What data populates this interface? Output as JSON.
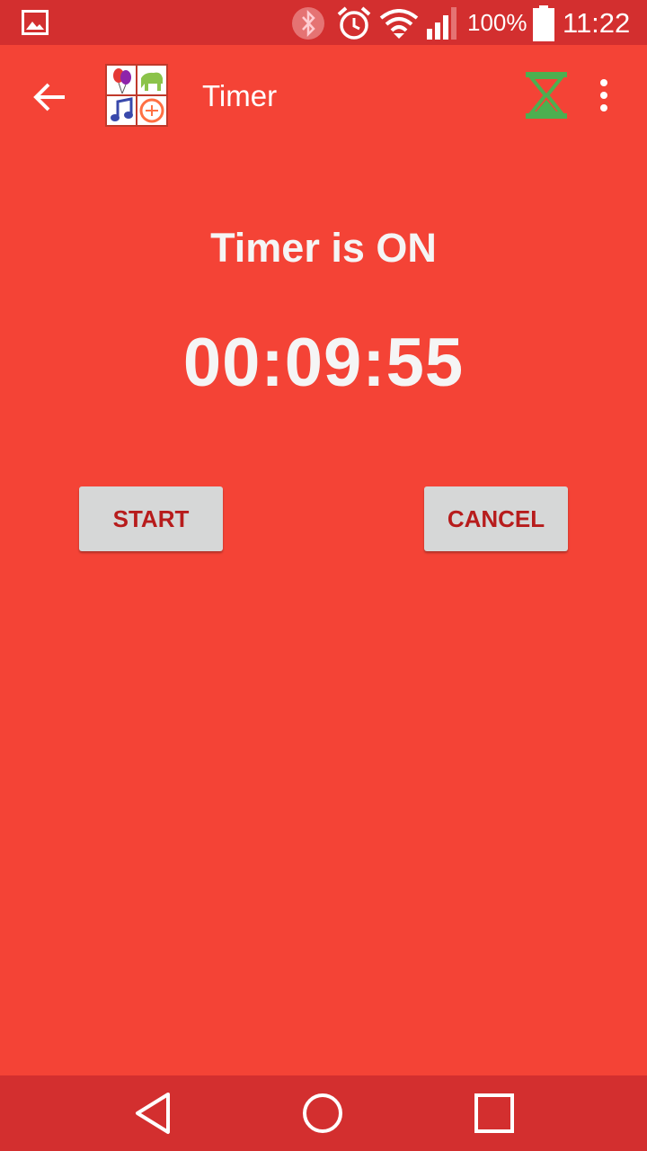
{
  "status_bar": {
    "battery_percent": "100%",
    "time": "11:22",
    "icons": [
      "gallery-icon",
      "bluetooth-icon",
      "alarm-icon",
      "wifi-icon",
      "signal-icon",
      "battery-icon"
    ]
  },
  "app_bar": {
    "title": "Timer",
    "icons": [
      "back-arrow-icon",
      "app-logo",
      "hourglass-icon",
      "overflow-menu-icon"
    ],
    "accent_icon_color": "#4caf50"
  },
  "main": {
    "status_text": "Timer is ON",
    "countdown": "00:09:55",
    "start_label": "START",
    "cancel_label": "CANCEL"
  },
  "nav_bar": {
    "icons": [
      "nav-back-icon",
      "nav-home-icon",
      "nav-recents-icon"
    ]
  },
  "colors": {
    "background": "#f44336",
    "status_bar": "#d32f2f",
    "button_bg": "#d6d7d7",
    "button_text": "#b71c1c"
  }
}
